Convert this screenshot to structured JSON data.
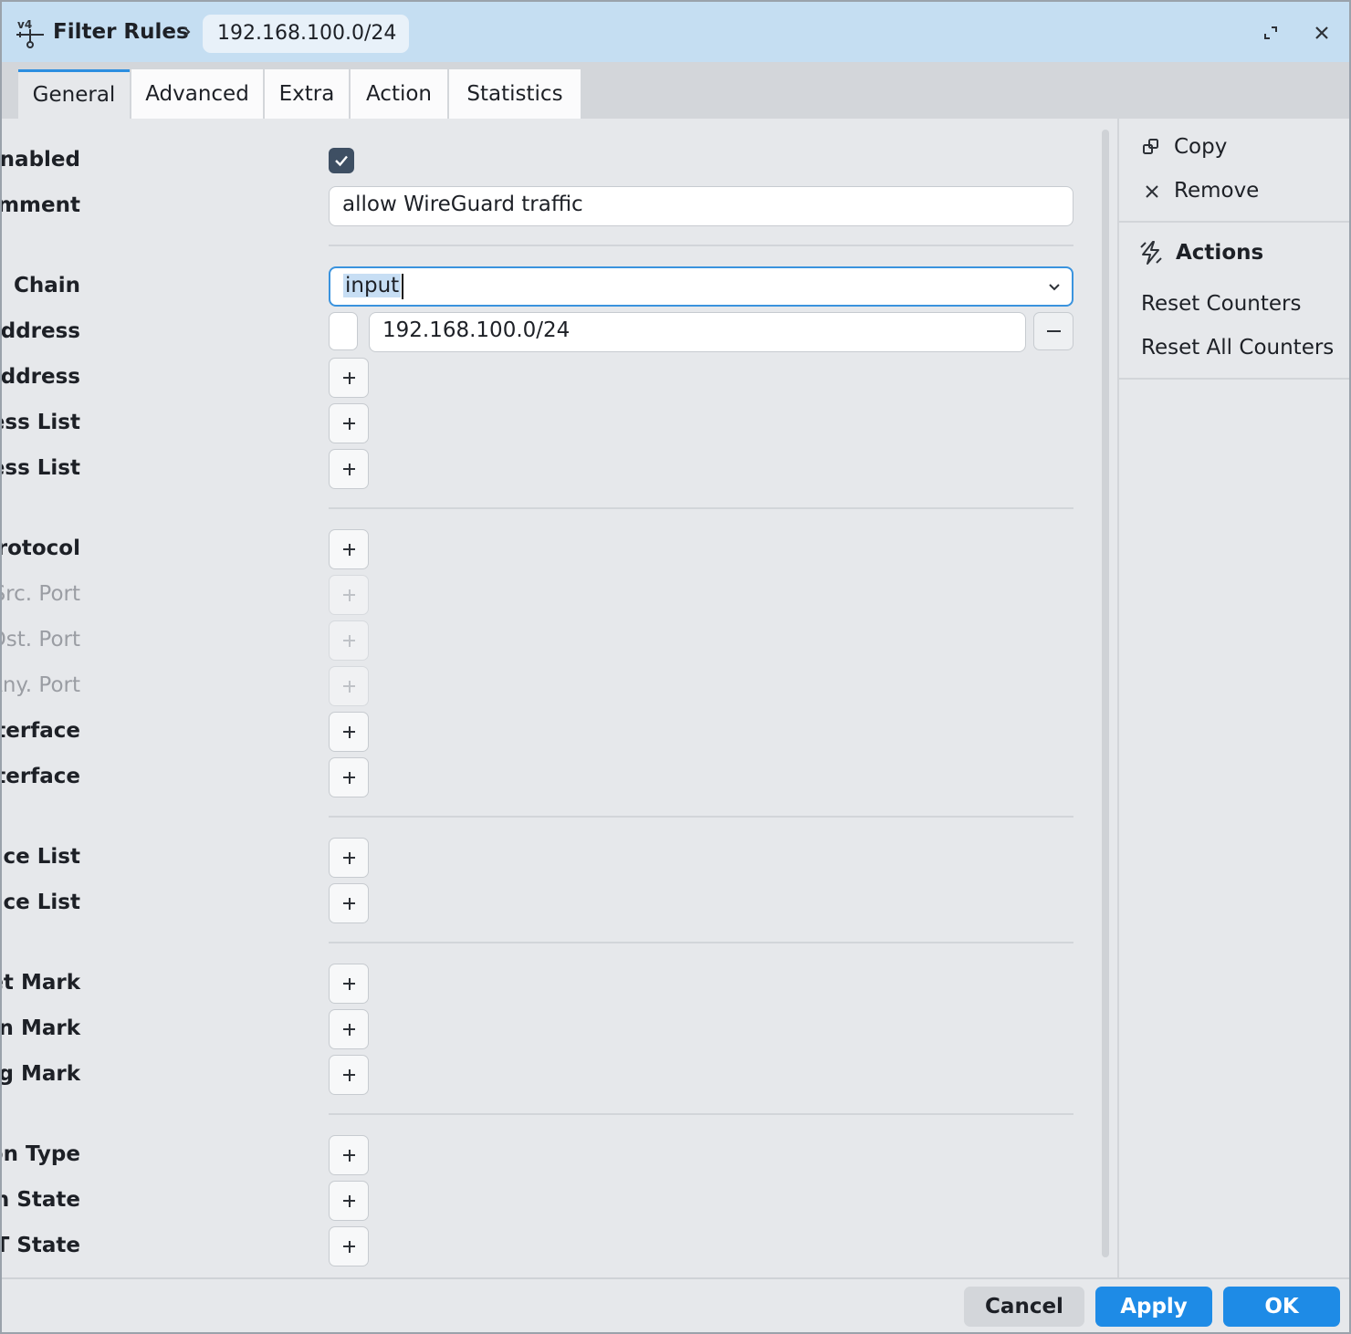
{
  "window": {
    "title": "Filter Rules",
    "breadcrumb_item": "192.168.100.0/24",
    "app_icon": "ipv4-route-icon",
    "restore_icon": "restore-window-icon",
    "close_icon": "close-icon"
  },
  "tabs": [
    {
      "label": "General",
      "active": true
    },
    {
      "label": "Advanced",
      "active": false
    },
    {
      "label": "Extra",
      "active": false
    },
    {
      "label": "Action",
      "active": false
    },
    {
      "label": "Statistics",
      "active": false
    }
  ],
  "form": {
    "enabled_label": "Enabled",
    "enabled_checked": true,
    "comment_label": "Comment",
    "comment_value": "allow WireGuard traffic",
    "chain_label": "Chain",
    "chain_value": "input",
    "src_address_label": "Src. Address",
    "src_address_value": "192.168.100.0/24",
    "dst_address_label": "Dst. Address",
    "src_address_list_label": "Src. Address List",
    "dst_address_list_label": "Dst. Address List",
    "protocol_label": "Protocol",
    "src_port_label": "Src. Port",
    "dst_port_label": "Dst. Port",
    "any_port_label": "Any. Port",
    "in_interface_label": "In. Interface",
    "out_interface_label": "Out. Interface",
    "in_interface_list_label": "In. Interface List",
    "out_interface_list_label": "Out. Interface List",
    "packet_mark_label": "Packet Mark",
    "connection_mark_label": "Connection Mark",
    "routing_mark_label": "Routing Mark",
    "connection_type_label": "Connection Type",
    "connection_state_label": "Connection State",
    "connection_nat_state_label": "Connection NAT State"
  },
  "side": {
    "copy": "Copy",
    "remove": "Remove",
    "actions_heading": "Actions",
    "reset_counters": "Reset Counters",
    "reset_all_counters": "Reset All Counters"
  },
  "footer": {
    "cancel": "Cancel",
    "apply": "Apply",
    "ok": "OK"
  },
  "colors": {
    "titlebar": "#c5def2",
    "accent": "#1e8be6",
    "checkbox": "#3e4f63"
  }
}
